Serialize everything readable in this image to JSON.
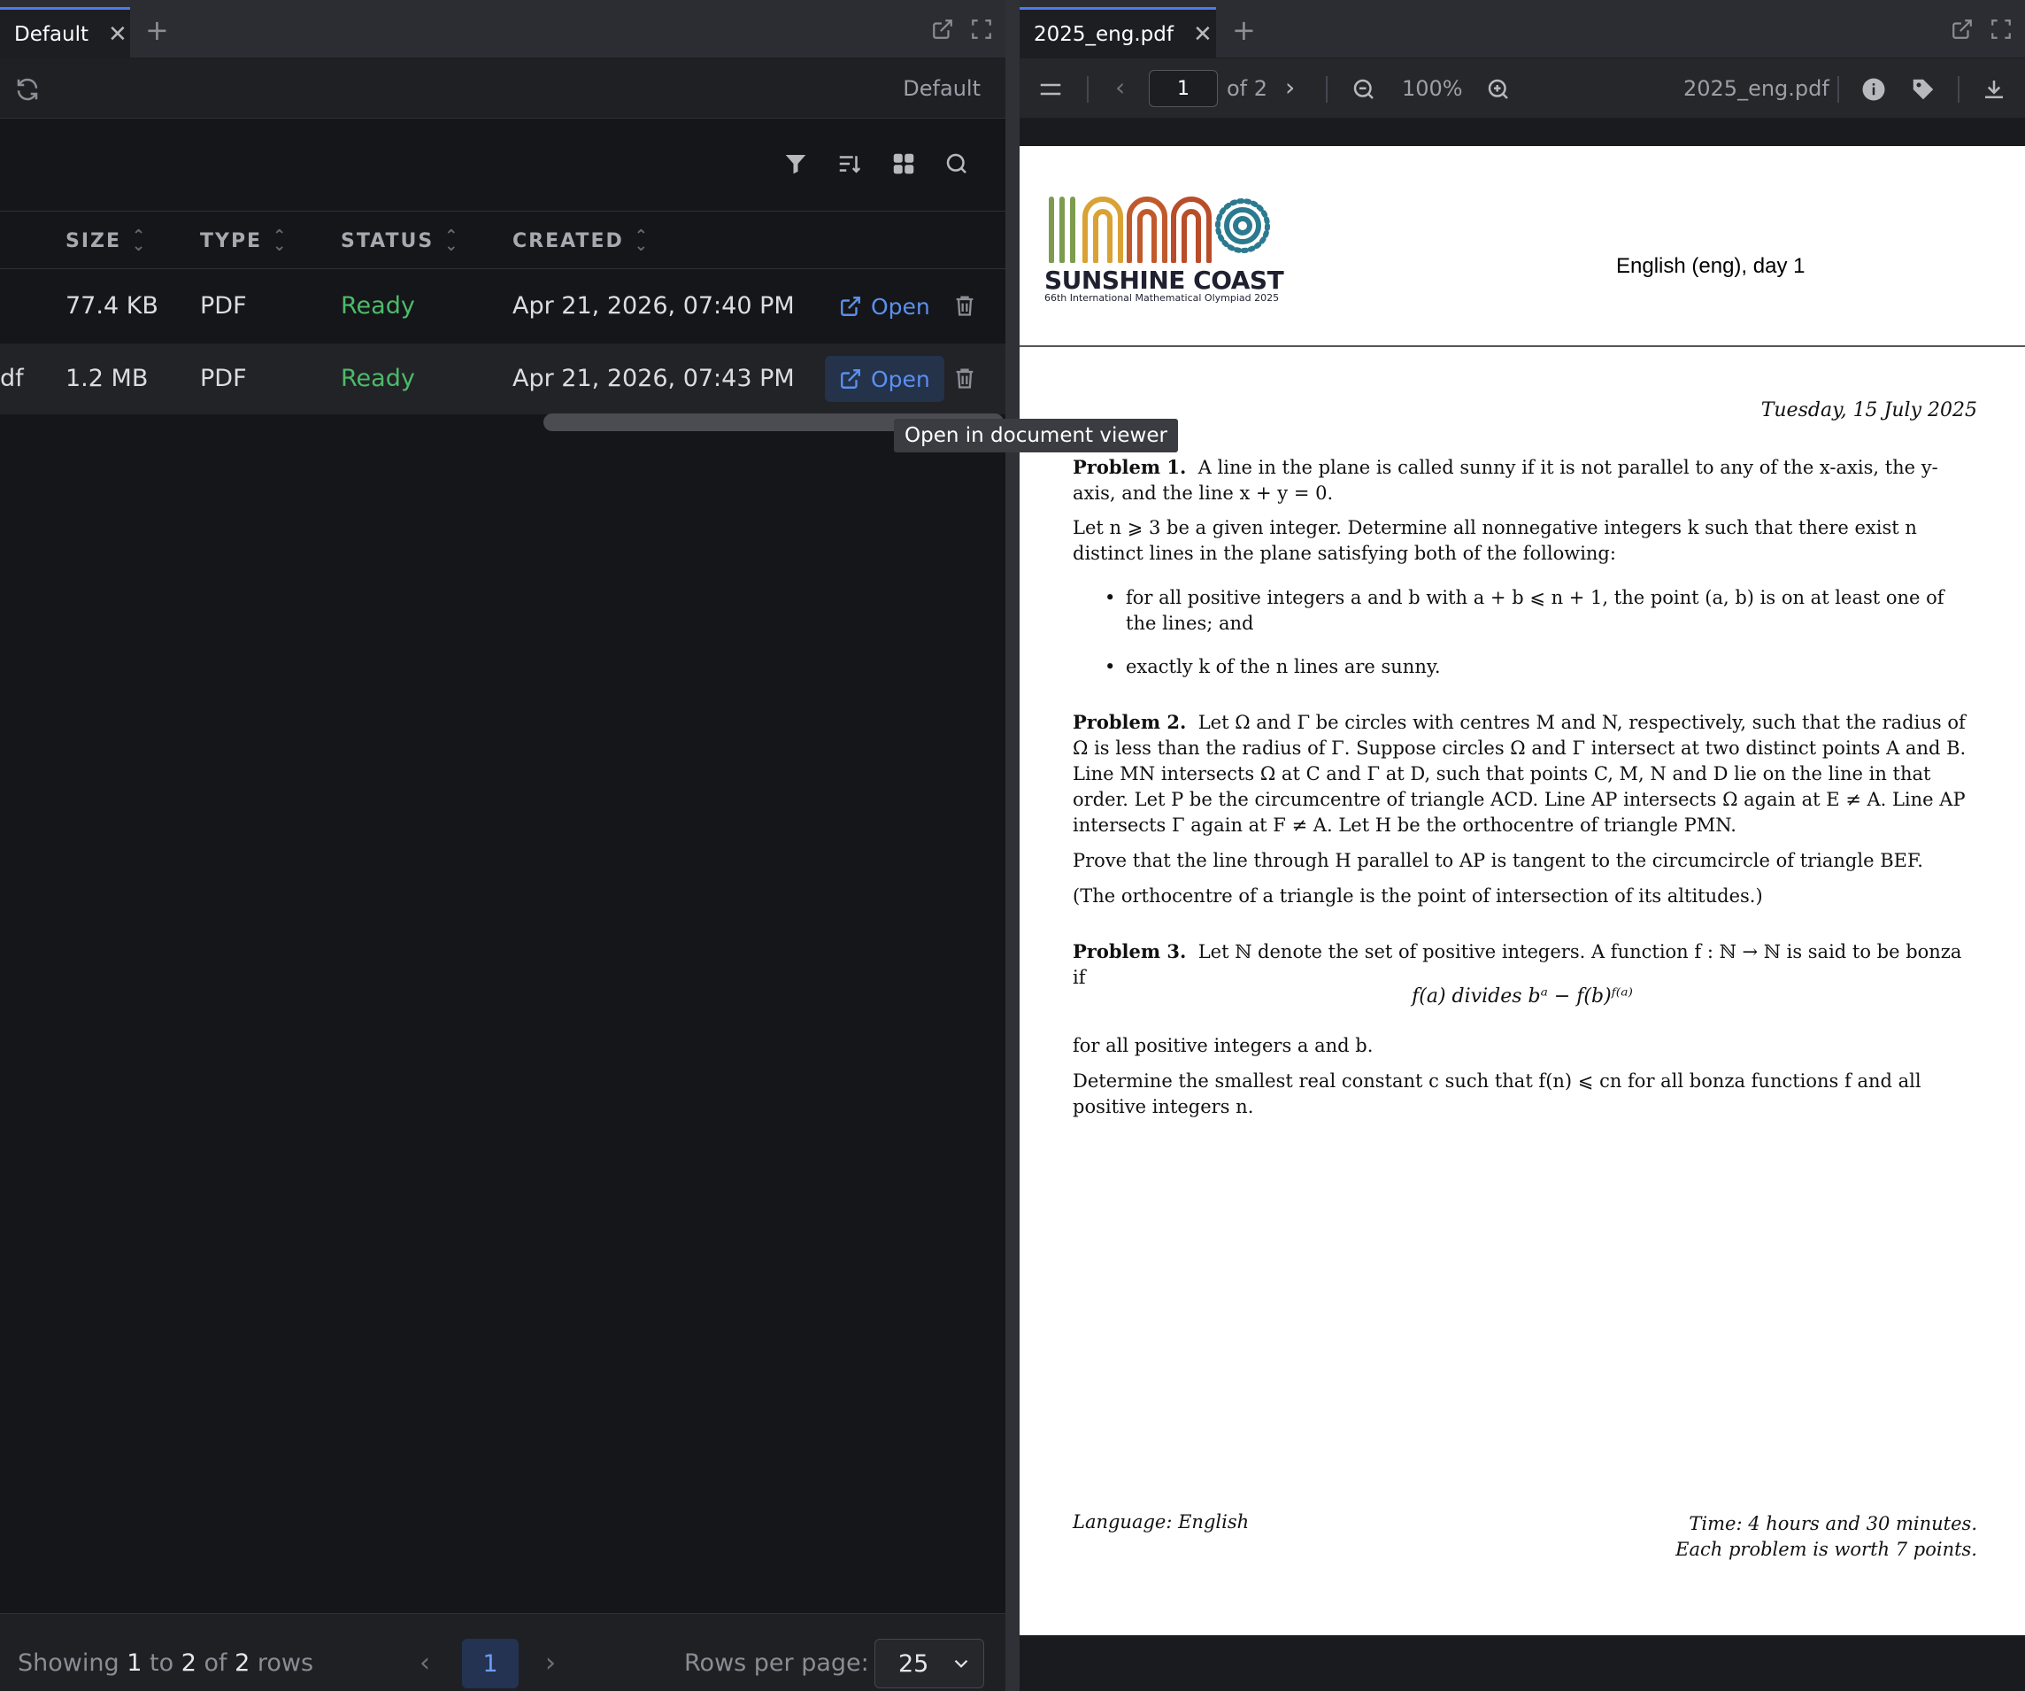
{
  "left_pane": {
    "tab": {
      "label": "Default"
    },
    "toolbar_title": "Default",
    "columns": [
      {
        "label": "SIZE"
      },
      {
        "label": "TYPE"
      },
      {
        "label": "STATUS"
      },
      {
        "label": "CREATED"
      }
    ],
    "rows": [
      {
        "name_fragment": "",
        "size": "77.4 KB",
        "type": "PDF",
        "status": "Ready",
        "created": "Apr 21, 2026, 07:40 PM",
        "open": "Open"
      },
      {
        "name_fragment": "df",
        "size": "1.2 MB",
        "type": "PDF",
        "status": "Ready",
        "created": "Apr 21, 2026, 07:43 PM",
        "open": "Open"
      }
    ],
    "tooltip": "Open in document viewer",
    "footer": {
      "showing_prefix": "Showing",
      "from": "1",
      "to_word": "to",
      "to": "2",
      "of_word": "of",
      "total": "2",
      "rows_word": "rows",
      "current_page": "1",
      "rows_per_page_label": "Rows per page:",
      "rows_per_page": "25"
    }
  },
  "right_pane": {
    "tab": {
      "label": "2025_eng.pdf"
    },
    "page_current": "1",
    "page_of": "of 2",
    "zoom": "100%",
    "file_name": "2025_eng.pdf",
    "document": {
      "brand": "SUNSHINE COAST",
      "brand_sub": "66th International Mathematical Olympiad 2025",
      "header": "English (eng), day 1",
      "date": "Tuesday, 15 July 2025",
      "p1_title": "Problem 1.",
      "p1_text": "A line in the plane is called sunny if it is not parallel to any of the x-axis, the y-axis, and the line x + y = 0.",
      "p1_text2": "Let n ⩾ 3 be a given integer. Determine all nonnegative integers k such that there exist n distinct lines in the plane satisfying both of the following:",
      "p1_b1": "for all positive integers a and b with a + b ⩽ n + 1, the point (a, b) is on at least one of the lines; and",
      "p1_b2": "exactly k of the n lines are sunny.",
      "p2_title": "Problem 2.",
      "p2_text": "Let Ω and Γ be circles with centres M and N, respectively, such that the radius of Ω is less than the radius of Γ. Suppose circles Ω and Γ intersect at two distinct points A and B. Line MN intersects Ω at C and Γ at D, such that points C, M, N and D lie on the line in that order. Let P be the circumcentre of triangle ACD. Line AP intersects Ω again at E ≠ A. Line AP intersects Γ again at F ≠ A. Let H be the orthocentre of triangle PMN.",
      "p2_text2": "Prove that the line through H parallel to AP is tangent to the circumcircle of triangle BEF.",
      "p2_text3": "(The orthocentre of a triangle is the point of intersection of its altitudes.)",
      "p3_title": "Problem 3.",
      "p3_text": "Let ℕ denote the set of positive integers. A function f : ℕ → ℕ is said to be bonza if",
      "p3_eq": "f(a)  divides  bᵃ − f(b)ᶠ⁽ᵃ⁾",
      "p3_text2": "for all positive integers a and b.",
      "p3_text3": "Determine the smallest real constant c such that f(n) ⩽ cn for all bonza functions f and all positive integers n.",
      "foot_left": "Language: English",
      "foot_right_1": "Time: 4 hours and 30 minutes.",
      "foot_right_2": "Each problem is worth 7 points."
    }
  },
  "colors": {
    "accent": "#4a7cf0",
    "ready": "#4cbb6a",
    "link": "#5b8ff0"
  }
}
